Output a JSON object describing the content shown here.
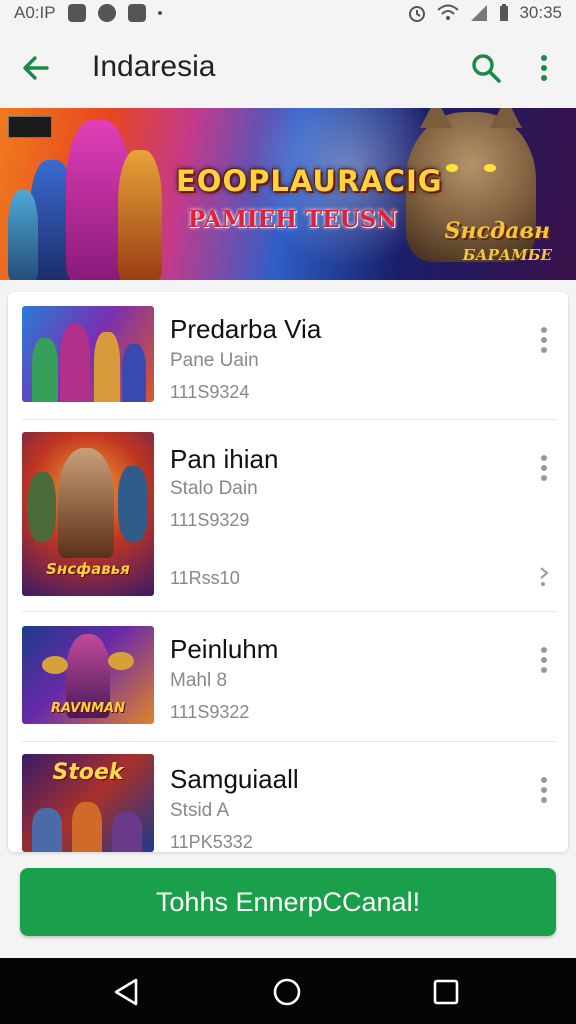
{
  "status_bar": {
    "left_text": "A0:IP",
    "time": "30:35",
    "icons": [
      "photo-icon",
      "circle-app-icon",
      "image-icon",
      "alarm-icon",
      "wifi-icon",
      "signal-icon",
      "battery-icon"
    ]
  },
  "toolbar": {
    "title": "Indaresia",
    "back_icon": "arrow-left-icon",
    "search_icon": "search-icon",
    "more_icon": "more-vert-icon"
  },
  "banner": {
    "title": "EOOPLAURACIG",
    "subtitle": "PAMIEH TEUSN",
    "logo_line1": "Sнсдавн",
    "logo_line2": "БАРАМБЕ"
  },
  "games": [
    {
      "name": "Predarba Via",
      "subtitle": "Pane Uain",
      "meta": "111S9324"
    },
    {
      "name": "Pan ihian",
      "subtitle": "Stalo Dain",
      "meta": "111S9329",
      "meta2": "11Rss10",
      "thumb_label": "Sнсфавья"
    },
    {
      "name": "Peinluhm",
      "subtitle": "Mahl 8",
      "meta": "111S9322",
      "thumb_label": "RAVNMAN"
    },
    {
      "name": "Samguiaall",
      "subtitle": "Stsid A",
      "meta": "11PK5332",
      "thumb_label": "Stoek"
    }
  ],
  "cta": {
    "label": "Tohhs EnnerpCCanal!"
  },
  "colors": {
    "accent": "#1aa04a",
    "icon_green": "#1b8a47",
    "background": "#f4f4f4"
  },
  "navbar": {
    "icons": [
      "back-triangle-icon",
      "home-circle-icon",
      "recents-square-icon"
    ]
  }
}
